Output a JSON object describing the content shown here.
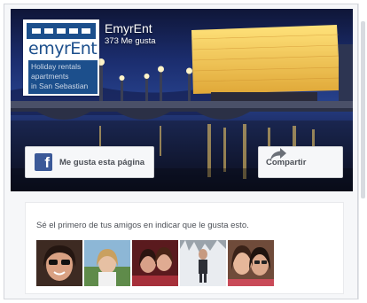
{
  "page": {
    "name": "EmyrEnt",
    "likes_text": "373 Me gusta"
  },
  "logo": {
    "brand": "emyrEnt",
    "tagline_lines": [
      "Holiday rentals",
      "apartments",
      "in San Sebastian"
    ],
    "brand_color": "#1c4f8c"
  },
  "buttons": {
    "like_label": "Me gusta esta página",
    "share_label": "Compartir"
  },
  "friends": {
    "prompt": "Sé el primero de tus amigos en indicar que le gusta esto.",
    "avatars": [
      {
        "name": "friend-avatar-1",
        "icon": "person-photo"
      },
      {
        "name": "friend-avatar-2",
        "icon": "person-photo"
      },
      {
        "name": "friend-avatar-3",
        "icon": "person-photo"
      },
      {
        "name": "friend-avatar-4",
        "icon": "person-photo"
      },
      {
        "name": "friend-avatar-5",
        "icon": "person-photo"
      }
    ]
  },
  "colors": {
    "facebook_blue": "#3b5998",
    "button_text": "#4b4f56",
    "widget_bg": "#f6f7f9"
  }
}
